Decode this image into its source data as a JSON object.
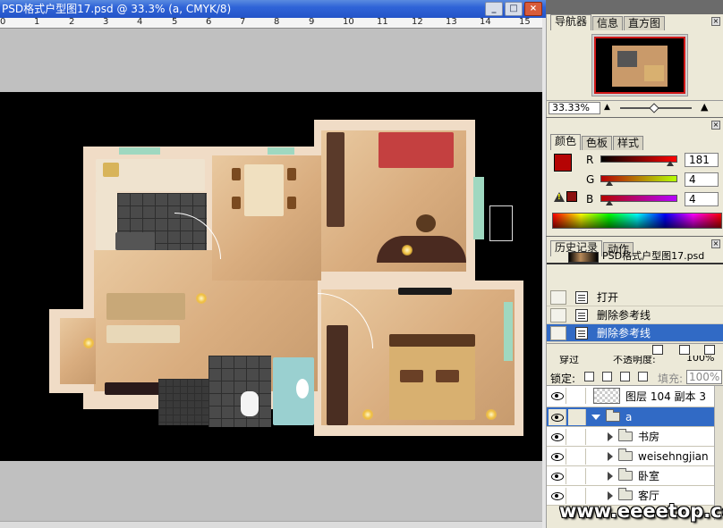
{
  "document": {
    "title": "PSD格式户型图17.psd @ 33.3% (a, CMYK/8)",
    "ruler_marks": [
      "0",
      "1",
      "2",
      "3",
      "4",
      "5",
      "6",
      "7",
      "8",
      "9",
      "10",
      "11",
      "12",
      "13",
      "14",
      "15"
    ]
  },
  "window_buttons": {
    "minimize": "_",
    "maximize": "□",
    "close": "×"
  },
  "navigator_panel": {
    "tabs": [
      "导航器",
      "信息",
      "直方图"
    ],
    "zoom_value": "33.33%"
  },
  "color_panel": {
    "tabs": [
      "颜色",
      "色板",
      "样式"
    ],
    "foreground_color": "#b50404",
    "channels": [
      {
        "label": "R",
        "value": "181"
      },
      {
        "label": "G",
        "value": "4"
      },
      {
        "label": "B",
        "value": "4"
      }
    ]
  },
  "history_panel": {
    "tabs": [
      "历史记录",
      "动作"
    ],
    "snapshot_name": "PSD格式户型图17.psd",
    "items": [
      {
        "label": "打开",
        "selected": false
      },
      {
        "label": "删除参考线",
        "selected": false
      },
      {
        "label": "删除参考线",
        "selected": true
      }
    ]
  },
  "layers_panel": {
    "blend_mode": "穿过",
    "opacity_label": "不透明度:",
    "opacity_value": "100%",
    "lock_label": "锁定:",
    "fill_label": "填充:",
    "fill_value": "100%",
    "layers": [
      {
        "name": "图层 104 副本 3",
        "type": "layer"
      },
      {
        "name": "a",
        "type": "group",
        "expanded": true,
        "selected": true
      },
      {
        "name": "书房",
        "type": "group",
        "expanded": false
      },
      {
        "name": "weisehngjian",
        "type": "group",
        "expanded": false
      },
      {
        "name": "卧室",
        "type": "group",
        "expanded": false
      },
      {
        "name": "客厅",
        "type": "group",
        "expanded": false
      }
    ]
  },
  "watermark": "www.eeeetop.com"
}
